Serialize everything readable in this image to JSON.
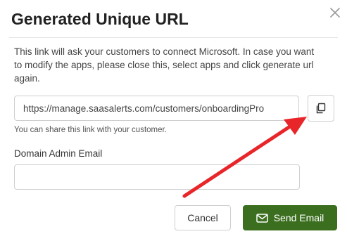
{
  "dialog": {
    "title": "Generated Unique URL",
    "close_icon": "close-icon",
    "description": "This link will ask your customers to connect Microsoft. In case you want to modify the apps, please close this, select apps and click generate url again.",
    "url": {
      "value": "https://manage.saasalerts.com/customers/onboardingPro",
      "copy_icon": "copy-icon"
    },
    "helper_text": "You can share this link with your customer.",
    "email": {
      "label": "Domain Admin Email",
      "value": "",
      "placeholder": ""
    },
    "buttons": {
      "cancel": "Cancel",
      "send": "Send Email",
      "send_icon": "mail-icon"
    },
    "annotation": {
      "arrow_color": "#e8262a"
    },
    "colors": {
      "primary": "#3b6f1f",
      "border": "#cfcfcf"
    }
  }
}
